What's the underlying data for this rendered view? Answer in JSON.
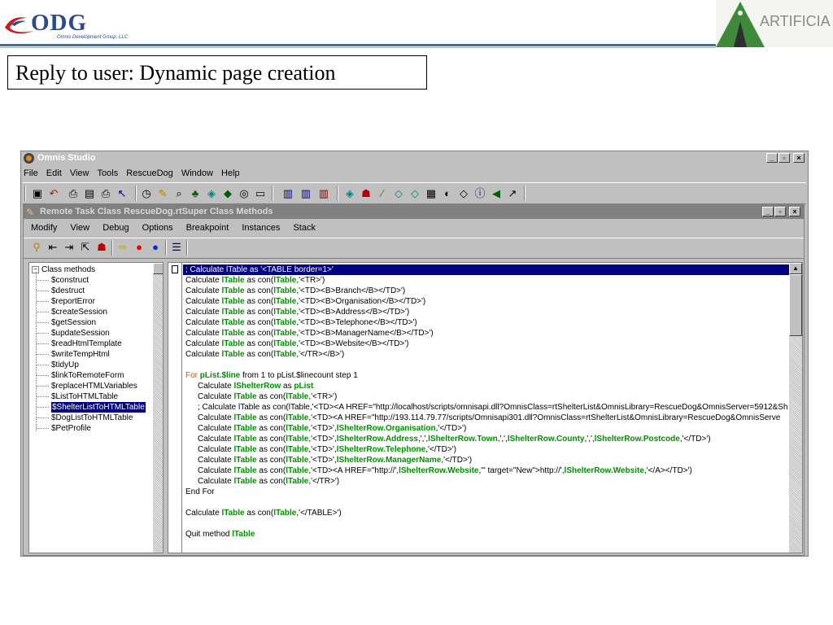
{
  "slide": {
    "title": "Reply to user: Dynamic page creation",
    "logo_left_text": "ODG",
    "logo_left_sub": "Omnis Development Group, LLC",
    "logo_right_text": "ARTIFICIA"
  },
  "window": {
    "title": "Omnis Studio",
    "menu": [
      "File",
      "Edit",
      "View",
      "Tools",
      "RescueDog",
      "Window",
      "Help"
    ],
    "controls": {
      "min": "_",
      "max": "▫",
      "close": "×"
    }
  },
  "subwindow": {
    "title": "Remote Task Class RescueDog.rtSuper Class Methods",
    "menu": [
      "Modify",
      "View",
      "Debug",
      "Options",
      "Breakpoint",
      "Instances",
      "Stack"
    ]
  },
  "tree": {
    "root": "Class methods",
    "items": [
      "$construct",
      "$destruct",
      "$reportError",
      "$createSession",
      "$getSession",
      "$updateSession",
      "$readHtmlTemplate",
      "$writeTempHtml",
      "$tidyUp",
      "$linkToRemoteForm",
      "$replaceHTMLVariables",
      "$ListToHTMLTable",
      "$ShelterListToHTMLTable",
      "$DogListToHTMLTable",
      "$PetProfile"
    ],
    "selected_index": 12
  },
  "code": {
    "lines": [
      "; Calculate lTable as '<TABLE border=1>'",
      "Calculate lTable as con(lTable,'<TR>')",
      "Calculate lTable as con(lTable,'<TD><B>Branch</B></TD>')",
      "Calculate lTable as con(lTable,'<TD><B>Organisation</B></TD>')",
      "Calculate lTable as con(lTable,'<TD><B>Address</B></TD>')",
      "Calculate lTable as con(lTable,'<TD><B>Telephone</B></TD>')",
      "Calculate lTable as con(lTable,'<TD><B>ManagerName</B></TD>')",
      "Calculate lTable as con(lTable,'<TD><B>Website</B></TD>')",
      "Calculate lTable as con(lTable,'</TR></B>')",
      "",
      "For pList.$line from 1 to pList.$linecount step 1",
      "Calculate lShelterRow as pList",
      "Calculate lTable as con(lTable,'<TR>')",
      "; Calculate lTable as con(lTable,'<TD><A HREF=\"http://localhost/scripts/omnisapi.dll?OmnisClass=rtShelterList&OmnisLibrary=RescueDog&OmnisServer=5912&Sh",
      "Calculate lTable as con(lTable,'<TD><A HREF=\"http://193.114.79.77/scripts/Omnisapi301.dll?OmnisClass=rtShelterList&OmnisLibrary=RescueDog&OmnisServe",
      "Calculate lTable as con(lTable,'<TD>',lShelterRow.Organisation,'</TD>')",
      "Calculate lTable as con(lTable,'<TD>',lShelterRow.Address,',',lShelterRow.Town,',',lShelterRow.County,',',lShelterRow.Postcode,'</TD>')",
      "Calculate lTable as con(lTable,'<TD>',lShelterRow.Telephone,'</TD>')",
      "Calculate lTable as con(lTable,'<TD>',lShelterRow.ManagerName,'</TD>')",
      "Calculate lTable as con(lTable,'<TD><A HREF=\"http://',lShelterRow.Website,'\" target=\"New\">http://',lShelterRow.Website,'</A></TD>')",
      "Calculate lTable as con(lTable,'</TR>')",
      "End For",
      "",
      "Calculate lTable as con(lTable,'</TABLE>')",
      "",
      "Quit method lTable"
    ],
    "selected_index": 0
  }
}
